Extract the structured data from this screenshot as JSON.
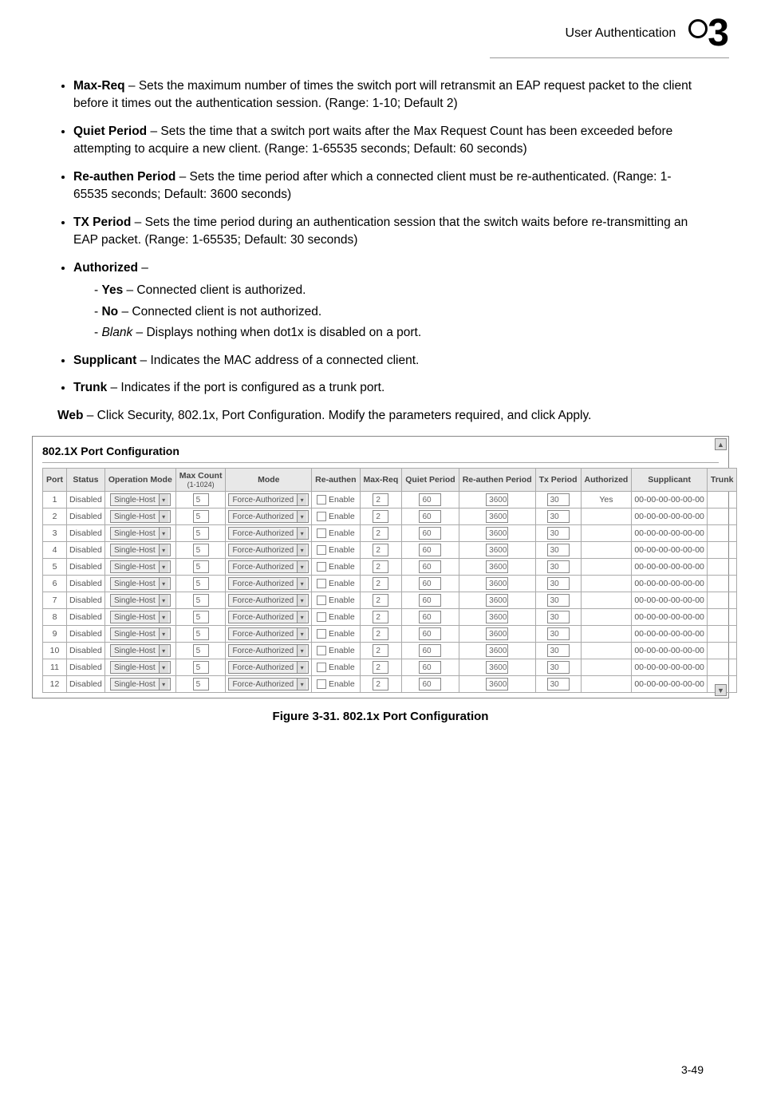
{
  "header": {
    "title": "User Authentication",
    "chapter": "3"
  },
  "bullets": [
    {
      "term": "Max-Req",
      "text": " – Sets the maximum number of times the switch port will retransmit an EAP request packet to the client before it times out the authentication session. (Range: 1-10; Default 2)"
    },
    {
      "term": "Quiet Period",
      "text": " – Sets the time that a switch port waits after the Max Request Count has been exceeded before attempting to acquire a new client. (Range: 1-65535 seconds; Default: 60 seconds)"
    },
    {
      "term": "Re-authen Period",
      "text": " – Sets the time period after which a connected client must be re-authenticated. (Range: 1-65535 seconds; Default: 3600 seconds)"
    },
    {
      "term": "TX Period",
      "text": " – Sets the time period during an authentication session that the switch waits before re-transmitting an EAP packet. (Range: 1-65535; Default: 30 seconds)"
    },
    {
      "term": "Authorized",
      "text": " –",
      "sub": [
        {
          "term": "Yes",
          "text": " – Connected client is authorized."
        },
        {
          "term": "No",
          "text": " – Connected client is not authorized."
        },
        {
          "term_italic": "Blank",
          "text": " – Displays nothing when dot1x is disabled on a port."
        }
      ]
    },
    {
      "term": "Supplicant",
      "text": " – Indicates the MAC address of a connected client."
    },
    {
      "term": "Trunk",
      "text": " – Indicates if the port is configured as a trunk port."
    }
  ],
  "web_para": {
    "prefix": "Web",
    "rest": " – Click Security, 802.1x, Port Configuration. Modify the parameters required, and click Apply."
  },
  "screenshot": {
    "title": "802.1X Port Configuration",
    "headers": [
      "Port",
      "Status",
      "Operation Mode",
      "Max Count (1-1024)",
      "Mode",
      "Re-authen",
      "Max-Req",
      "Quiet Period",
      "Re-authen Period",
      "Tx Period",
      "Authorized",
      "Supplicant",
      "Trunk"
    ],
    "headers_short": [
      "Port",
      "Status",
      "Operation Mode",
      "Max Count",
      "Mode",
      "Re-authen",
      "Max-Req",
      "Quiet Period",
      "Re-authen Period",
      "Tx Period",
      "Authorized",
      "Supplicant",
      "Trunk"
    ],
    "maxcount_sub": "(1-1024)",
    "rows": [
      {
        "port": "1",
        "status": "Disabled",
        "op": "Single-Host",
        "maxc": "5",
        "mode": "Force-Authorized",
        "reauth_en": "Enable",
        "maxreq": "2",
        "quiet": "60",
        "reauth_p": "3600",
        "tx": "30",
        "auth": "Yes",
        "supp": "00-00-00-00-00-00",
        "trunk": ""
      },
      {
        "port": "2",
        "status": "Disabled",
        "op": "Single-Host",
        "maxc": "5",
        "mode": "Force-Authorized",
        "reauth_en": "Enable",
        "maxreq": "2",
        "quiet": "60",
        "reauth_p": "3600",
        "tx": "30",
        "auth": "",
        "supp": "00-00-00-00-00-00",
        "trunk": ""
      },
      {
        "port": "3",
        "status": "Disabled",
        "op": "Single-Host",
        "maxc": "5",
        "mode": "Force-Authorized",
        "reauth_en": "Enable",
        "maxreq": "2",
        "quiet": "60",
        "reauth_p": "3600",
        "tx": "30",
        "auth": "",
        "supp": "00-00-00-00-00-00",
        "trunk": ""
      },
      {
        "port": "4",
        "status": "Disabled",
        "op": "Single-Host",
        "maxc": "5",
        "mode": "Force-Authorized",
        "reauth_en": "Enable",
        "maxreq": "2",
        "quiet": "60",
        "reauth_p": "3600",
        "tx": "30",
        "auth": "",
        "supp": "00-00-00-00-00-00",
        "trunk": ""
      },
      {
        "port": "5",
        "status": "Disabled",
        "op": "Single-Host",
        "maxc": "5",
        "mode": "Force-Authorized",
        "reauth_en": "Enable",
        "maxreq": "2",
        "quiet": "60",
        "reauth_p": "3600",
        "tx": "30",
        "auth": "",
        "supp": "00-00-00-00-00-00",
        "trunk": ""
      },
      {
        "port": "6",
        "status": "Disabled",
        "op": "Single-Host",
        "maxc": "5",
        "mode": "Force-Authorized",
        "reauth_en": "Enable",
        "maxreq": "2",
        "quiet": "60",
        "reauth_p": "3600",
        "tx": "30",
        "auth": "",
        "supp": "00-00-00-00-00-00",
        "trunk": ""
      },
      {
        "port": "7",
        "status": "Disabled",
        "op": "Single-Host",
        "maxc": "5",
        "mode": "Force-Authorized",
        "reauth_en": "Enable",
        "maxreq": "2",
        "quiet": "60",
        "reauth_p": "3600",
        "tx": "30",
        "auth": "",
        "supp": "00-00-00-00-00-00",
        "trunk": ""
      },
      {
        "port": "8",
        "status": "Disabled",
        "op": "Single-Host",
        "maxc": "5",
        "mode": "Force-Authorized",
        "reauth_en": "Enable",
        "maxreq": "2",
        "quiet": "60",
        "reauth_p": "3600",
        "tx": "30",
        "auth": "",
        "supp": "00-00-00-00-00-00",
        "trunk": ""
      },
      {
        "port": "9",
        "status": "Disabled",
        "op": "Single-Host",
        "maxc": "5",
        "mode": "Force-Authorized",
        "reauth_en": "Enable",
        "maxreq": "2",
        "quiet": "60",
        "reauth_p": "3600",
        "tx": "30",
        "auth": "",
        "supp": "00-00-00-00-00-00",
        "trunk": ""
      },
      {
        "port": "10",
        "status": "Disabled",
        "op": "Single-Host",
        "maxc": "5",
        "mode": "Force-Authorized",
        "reauth_en": "Enable",
        "maxreq": "2",
        "quiet": "60",
        "reauth_p": "3600",
        "tx": "30",
        "auth": "",
        "supp": "00-00-00-00-00-00",
        "trunk": ""
      },
      {
        "port": "11",
        "status": "Disabled",
        "op": "Single-Host",
        "maxc": "5",
        "mode": "Force-Authorized",
        "reauth_en": "Enable",
        "maxreq": "2",
        "quiet": "60",
        "reauth_p": "3600",
        "tx": "30",
        "auth": "",
        "supp": "00-00-00-00-00-00",
        "trunk": ""
      },
      {
        "port": "12",
        "status": "Disabled",
        "op": "Single-Host",
        "maxc": "5",
        "mode": "Force-Authorized",
        "reauth_en": "Enable",
        "maxreq": "2",
        "quiet": "60",
        "reauth_p": "3600",
        "tx": "30",
        "auth": "",
        "supp": "00-00-00-00-00-00",
        "trunk": ""
      }
    ]
  },
  "figure_caption": "Figure 3-31.  802.1x Port Configuration",
  "page_number": "3-49"
}
